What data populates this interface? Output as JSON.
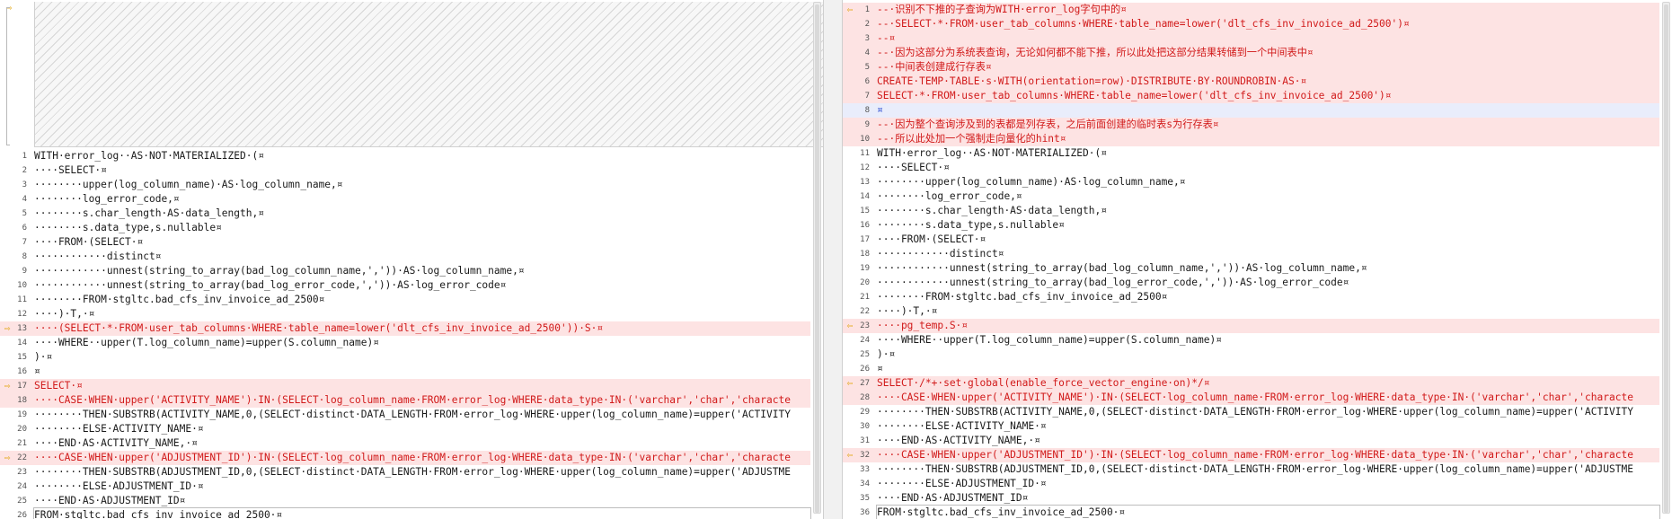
{
  "colors": {
    "diff_bg": "#fde3e3",
    "diff_text": "#d11a1a",
    "blank_bg": "#e9edfb",
    "marker": "#e0a100"
  },
  "icons": {
    "change_marker_left": "arrow-right-icon",
    "change_marker_right": "arrow-left-icon"
  },
  "left": {
    "placeholder_note": "",
    "lines": [
      {
        "num": "1",
        "text": "WITH·error_log··AS·NOT·MATERIALIZED·(¤",
        "state": "normal",
        "marker": false
      },
      {
        "num": "2",
        "text": "····SELECT·¤",
        "state": "normal",
        "marker": false
      },
      {
        "num": "3",
        "text": "········upper(log_column_name)·AS·log_column_name,¤",
        "state": "normal",
        "marker": false
      },
      {
        "num": "4",
        "text": "········log_error_code,¤",
        "state": "normal",
        "marker": false
      },
      {
        "num": "5",
        "text": "········s.char_length·AS·data_length,¤",
        "state": "normal",
        "marker": false
      },
      {
        "num": "6",
        "text": "········s.data_type,s.nullable¤",
        "state": "normal",
        "marker": false
      },
      {
        "num": "7",
        "text": "····FROM·(SELECT·¤",
        "state": "normal",
        "marker": false
      },
      {
        "num": "8",
        "text": "············distinct¤",
        "state": "normal",
        "marker": false
      },
      {
        "num": "9",
        "text": "············unnest(string_to_array(bad_log_column_name,','))·AS·log_column_name,¤",
        "state": "normal",
        "marker": false
      },
      {
        "num": "10",
        "text": "············unnest(string_to_array(bad_log_error_code,','))·AS·log_error_code¤",
        "state": "normal",
        "marker": false
      },
      {
        "num": "11",
        "text": "········FROM·stgltc.bad_cfs_inv_invoice_ad_2500¤",
        "state": "normal",
        "marker": false
      },
      {
        "num": "12",
        "text": "····)·T,·¤",
        "state": "normal",
        "marker": false
      },
      {
        "num": "13",
        "text": "····(SELECT·*·FROM·user_tab_columns·WHERE·table_name=lower('dlt_cfs_inv_invoice_ad_2500'))·S·¤",
        "state": "diff",
        "marker": true
      },
      {
        "num": "14",
        "text": "····WHERE··upper(T.log_column_name)=upper(S.column_name)¤",
        "state": "normal",
        "marker": false
      },
      {
        "num": "15",
        "text": ")·¤",
        "state": "normal",
        "marker": false
      },
      {
        "num": "16",
        "text": "¤",
        "state": "normal",
        "marker": false
      },
      {
        "num": "17",
        "text": "SELECT·¤",
        "state": "diff",
        "marker": true
      },
      {
        "num": "18",
        "text": "····CASE·WHEN·upper('ACTIVITY_NAME')·IN·(SELECT·log_column_name·FROM·error_log·WHERE·data_type·IN·('varchar','char','characte",
        "state": "diff",
        "marker": false
      },
      {
        "num": "19",
        "text": "········THEN·SUBSTRB(ACTIVITY_NAME,0,(SELECT·distinct·DATA_LENGTH·FROM·error_log·WHERE·upper(log_column_name)=upper('ACTIVITY",
        "state": "normal",
        "marker": false
      },
      {
        "num": "20",
        "text": "········ELSE·ACTIVITY_NAME·¤",
        "state": "normal",
        "marker": false
      },
      {
        "num": "21",
        "text": "····END·AS·ACTIVITY_NAME,·¤",
        "state": "normal",
        "marker": false
      },
      {
        "num": "22",
        "text": "····CASE·WHEN·upper('ADJUSTMENT_ID')·IN·(SELECT·log_column_name·FROM·error_log·WHERE·data_type·IN·('varchar','char','characte",
        "state": "diff",
        "marker": true
      },
      {
        "num": "23",
        "text": "········THEN·SUBSTRB(ADJUSTMENT_ID,0,(SELECT·distinct·DATA_LENGTH·FROM·error_log·WHERE·upper(log_column_name)=upper('ADJUSTME",
        "state": "normal",
        "marker": false
      },
      {
        "num": "24",
        "text": "········ELSE·ADJUSTMENT_ID·¤",
        "state": "normal",
        "marker": false
      },
      {
        "num": "25",
        "text": "····END·AS·ADJUSTMENT_ID¤",
        "state": "normal",
        "marker": false
      },
      {
        "num": "26",
        "text": "FROM·stgltc.bad_cfs_inv_invoice_ad_2500·¤",
        "state": "cursor",
        "marker": false
      }
    ]
  },
  "right": {
    "lines": [
      {
        "num": "1",
        "text": "--·识别不下推的子查询为WITH·error_log字句中的¤",
        "state": "diff",
        "marker": true
      },
      {
        "num": "2",
        "text": "--·SELECT·*·FROM·user_tab_columns·WHERE·table_name=lower('dlt_cfs_inv_invoice_ad_2500')¤",
        "state": "diff",
        "marker": false
      },
      {
        "num": "3",
        "text": "--¤",
        "state": "diff",
        "marker": false
      },
      {
        "num": "4",
        "text": "--·因为这部分为系统表查询，无论如何都不能下推，所以此处把这部分结果转储到一个中间表中¤",
        "state": "diff",
        "marker": false
      },
      {
        "num": "5",
        "text": "--·中间表创建成行存表¤",
        "state": "diff",
        "marker": false
      },
      {
        "num": "6",
        "text": "CREATE·TEMP·TABLE·s·WITH(orientation=row)·DISTRIBUTE·BY·ROUNDROBIN·AS·¤",
        "state": "diff",
        "marker": false
      },
      {
        "num": "7",
        "text": "SELECT·*·FROM·user_tab_columns·WHERE·table_name=lower('dlt_cfs_inv_invoice_ad_2500')¤",
        "state": "diff",
        "marker": false
      },
      {
        "num": "8",
        "text": "¤",
        "state": "blue",
        "marker": false
      },
      {
        "num": "9",
        "text": "--·因为整个查询涉及到的表都是列存表，之后前面创建的临时表s为行存表¤",
        "state": "diff",
        "marker": false
      },
      {
        "num": "10",
        "text": "--·所以此处加一个强制走向量化的hint¤",
        "state": "diff",
        "marker": false
      },
      {
        "num": "11",
        "text": "WITH·error_log··AS·NOT·MATERIALIZED·(¤",
        "state": "normal",
        "marker": false
      },
      {
        "num": "12",
        "text": "····SELECT·¤",
        "state": "normal",
        "marker": false
      },
      {
        "num": "13",
        "text": "········upper(log_column_name)·AS·log_column_name,¤",
        "state": "normal",
        "marker": false
      },
      {
        "num": "14",
        "text": "········log_error_code,¤",
        "state": "normal",
        "marker": false
      },
      {
        "num": "15",
        "text": "········s.char_length·AS·data_length,¤",
        "state": "normal",
        "marker": false
      },
      {
        "num": "16",
        "text": "········s.data_type,s.nullable¤",
        "state": "normal",
        "marker": false
      },
      {
        "num": "17",
        "text": "····FROM·(SELECT·¤",
        "state": "normal",
        "marker": false
      },
      {
        "num": "18",
        "text": "············distinct¤",
        "state": "normal",
        "marker": false
      },
      {
        "num": "19",
        "text": "············unnest(string_to_array(bad_log_column_name,','))·AS·log_column_name,¤",
        "state": "normal",
        "marker": false
      },
      {
        "num": "20",
        "text": "············unnest(string_to_array(bad_log_error_code,','))·AS·log_error_code¤",
        "state": "normal",
        "marker": false
      },
      {
        "num": "21",
        "text": "········FROM·stgltc.bad_cfs_inv_invoice_ad_2500¤",
        "state": "normal",
        "marker": false
      },
      {
        "num": "22",
        "text": "····)·T,·¤",
        "state": "normal",
        "marker": false
      },
      {
        "num": "23",
        "text": "····pg_temp.S·¤",
        "state": "diff",
        "marker": true
      },
      {
        "num": "24",
        "text": "····WHERE··upper(T.log_column_name)=upper(S.column_name)¤",
        "state": "normal",
        "marker": false
      },
      {
        "num": "25",
        "text": ")·¤",
        "state": "normal",
        "marker": false
      },
      {
        "num": "26",
        "text": "¤",
        "state": "normal",
        "marker": false
      },
      {
        "num": "27",
        "text": "SELECT·/*+·set·global(enable_force_vector_engine·on)*/¤",
        "state": "diff",
        "marker": true
      },
      {
        "num": "28",
        "text": "····CASE·WHEN·upper('ACTIVITY_NAME')·IN·(SELECT·log_column_name·FROM·error_log·WHERE·data_type·IN·('varchar','char','characte",
        "state": "diff",
        "marker": false
      },
      {
        "num": "29",
        "text": "········THEN·SUBSTRB(ACTIVITY_NAME,0,(SELECT·distinct·DATA_LENGTH·FROM·error_log·WHERE·upper(log_column_name)=upper('ACTIVITY",
        "state": "normal",
        "marker": false
      },
      {
        "num": "30",
        "text": "········ELSE·ACTIVITY_NAME·¤",
        "state": "normal",
        "marker": false
      },
      {
        "num": "31",
        "text": "····END·AS·ACTIVITY_NAME,·¤",
        "state": "normal",
        "marker": false
      },
      {
        "num": "32",
        "text": "····CASE·WHEN·upper('ADJUSTMENT_ID')·IN·(SELECT·log_column_name·FROM·error_log·WHERE·data_type·IN·('varchar','char','characte",
        "state": "diff",
        "marker": true
      },
      {
        "num": "33",
        "text": "········THEN·SUBSTRB(ADJUSTMENT_ID,0,(SELECT·distinct·DATA_LENGTH·FROM·error_log·WHERE·upper(log_column_name)=upper('ADJUSTME",
        "state": "normal",
        "marker": false
      },
      {
        "num": "34",
        "text": "········ELSE·ADJUSTMENT_ID·¤",
        "state": "normal",
        "marker": false
      },
      {
        "num": "35",
        "text": "····END·AS·ADJUSTMENT_ID¤",
        "state": "normal",
        "marker": false
      },
      {
        "num": "36",
        "text": "FROM·stgltc.bad_cfs_inv_invoice_ad_2500·¤",
        "state": "cursor",
        "marker": false
      }
    ]
  }
}
